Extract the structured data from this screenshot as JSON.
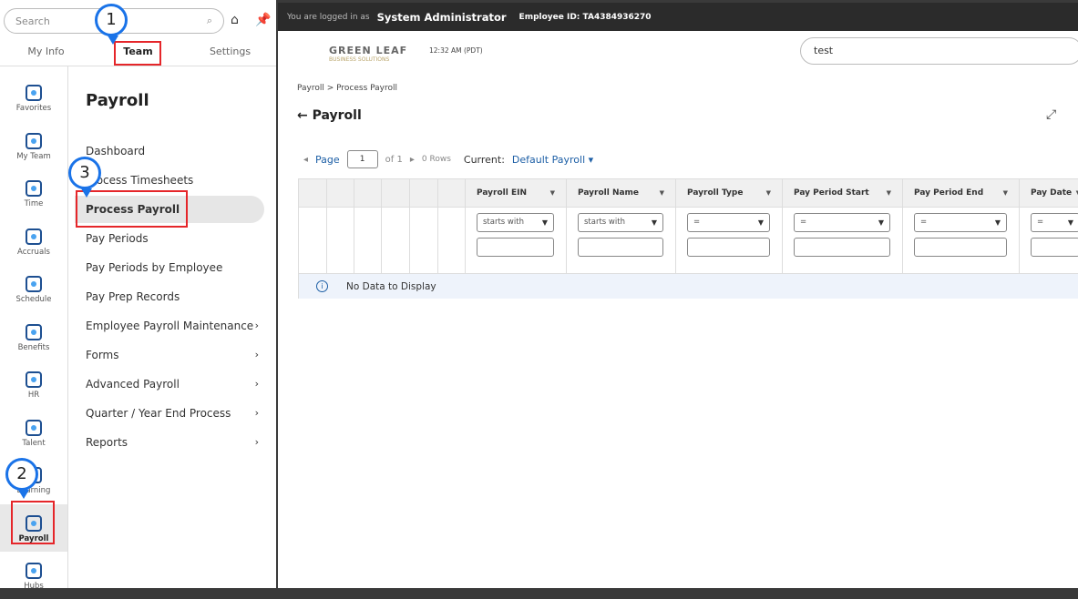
{
  "left": {
    "search_placeholder": "Search",
    "tabs": [
      "My Info",
      "Team",
      "Settings"
    ],
    "rail": [
      "Favorites",
      "My Team",
      "Time",
      "Accruals",
      "Schedule",
      "Benefits",
      "HR",
      "Talent",
      "Learning",
      "Payroll",
      "Hubs"
    ],
    "menu_title": "Payroll",
    "menu": [
      {
        "label": "Dashboard",
        "chev": ""
      },
      {
        "label": "Process Timesheets",
        "chev": ""
      },
      {
        "label": "Process Payroll",
        "chev": ""
      },
      {
        "label": "Pay Periods",
        "chev": ""
      },
      {
        "label": "Pay Periods by Employee",
        "chev": ""
      },
      {
        "label": "Pay Prep Records",
        "chev": ""
      },
      {
        "label": "Employee Payroll Maintenance",
        "chev": "›"
      },
      {
        "label": "Forms",
        "chev": "›"
      },
      {
        "label": "Advanced Payroll",
        "chev": "›"
      },
      {
        "label": "Quarter / Year End Process",
        "chev": "›"
      },
      {
        "label": "Reports",
        "chev": "›"
      }
    ]
  },
  "topbar": {
    "logged": "You are logged in as",
    "user": "System Administrator",
    "employee": "Employee ID: TA4384936270"
  },
  "header": {
    "logo": "GREEN LEAF",
    "logo_sub": "BUSINESS SOLUTIONS",
    "time": "12:32 AM (PDT)",
    "search_value": "test"
  },
  "breadcrumb": "Payroll > Process Payroll",
  "title": "Payroll",
  "pager": {
    "page_label": "Page",
    "page": "1",
    "of": "of 1",
    "rows": "0 Rows",
    "current_label": "Current:",
    "current": "Default Payroll"
  },
  "grid": {
    "columns": [
      {
        "name": "Payroll EIN",
        "op": "starts with"
      },
      {
        "name": "Payroll Name",
        "op": "starts with"
      },
      {
        "name": "Payroll Type",
        "op": "="
      },
      {
        "name": "Pay Period Start",
        "op": "="
      },
      {
        "name": "Pay Period End",
        "op": "="
      },
      {
        "name": "Pay Date",
        "op": "="
      }
    ],
    "empty": "No Data to Display"
  },
  "annotations": [
    "1",
    "2",
    "3"
  ],
  "colors": {
    "accent": "#1d5fa6",
    "annotation_pin": "#1a73e8",
    "annotation_box": "#e5262a",
    "topbar": "#2b2b2b"
  }
}
